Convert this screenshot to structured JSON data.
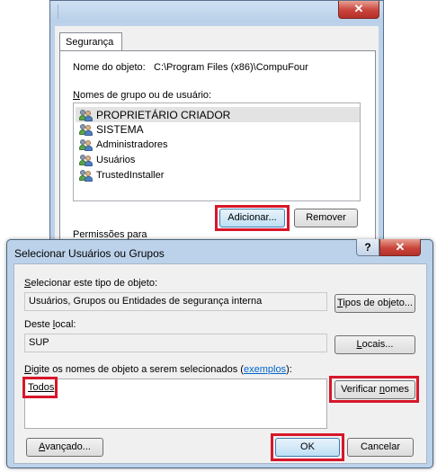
{
  "back_dialog": {
    "close_glyph": "✕",
    "tab_label": "Segurança",
    "object_name_label": "Nome do objeto:",
    "object_name_value": "C:\\Program Files (x86)\\CompuFour",
    "groups_label": "Nomes de grupo ou de usuário:",
    "groups": [
      {
        "label": "PROPRIETÁRIO CRIADOR",
        "icon": "users-icon"
      },
      {
        "label": "SISTEMA",
        "icon": "users-icon"
      },
      {
        "label": "Administradores",
        "icon": "users-icon"
      },
      {
        "label": "Usuários",
        "icon": "users-icon"
      },
      {
        "label": "TrustedInstaller",
        "icon": "users-icon"
      }
    ],
    "add_label": "Adicionar...",
    "remove_label": "Remover",
    "permissions_label": "Permissões para"
  },
  "front_dialog": {
    "title": "Selecionar Usuários ou Grupos",
    "help_glyph": "?",
    "close_glyph": "✕",
    "object_type_label": "Selecionar este tipo de objeto:",
    "object_type_value": "Usuários, Grupos ou Entidades de segurança interna",
    "object_types_button": "Tipos de objeto...",
    "location_label": "Deste local:",
    "location_value": "SUP",
    "locations_button": "Locais...",
    "names_label": "Digite os nomes de objeto a serem selecionados (",
    "examples_link": "exemplos",
    "names_label_end": "):",
    "names_value": "Todos",
    "check_names_button": "Verificar nomes",
    "advanced_button": "Avançado...",
    "ok_button": "OK",
    "cancel_button": "Cancelar"
  },
  "colors": {
    "highlight": "#d7172a",
    "link": "#0066cc",
    "close_red": "#c9443b"
  }
}
